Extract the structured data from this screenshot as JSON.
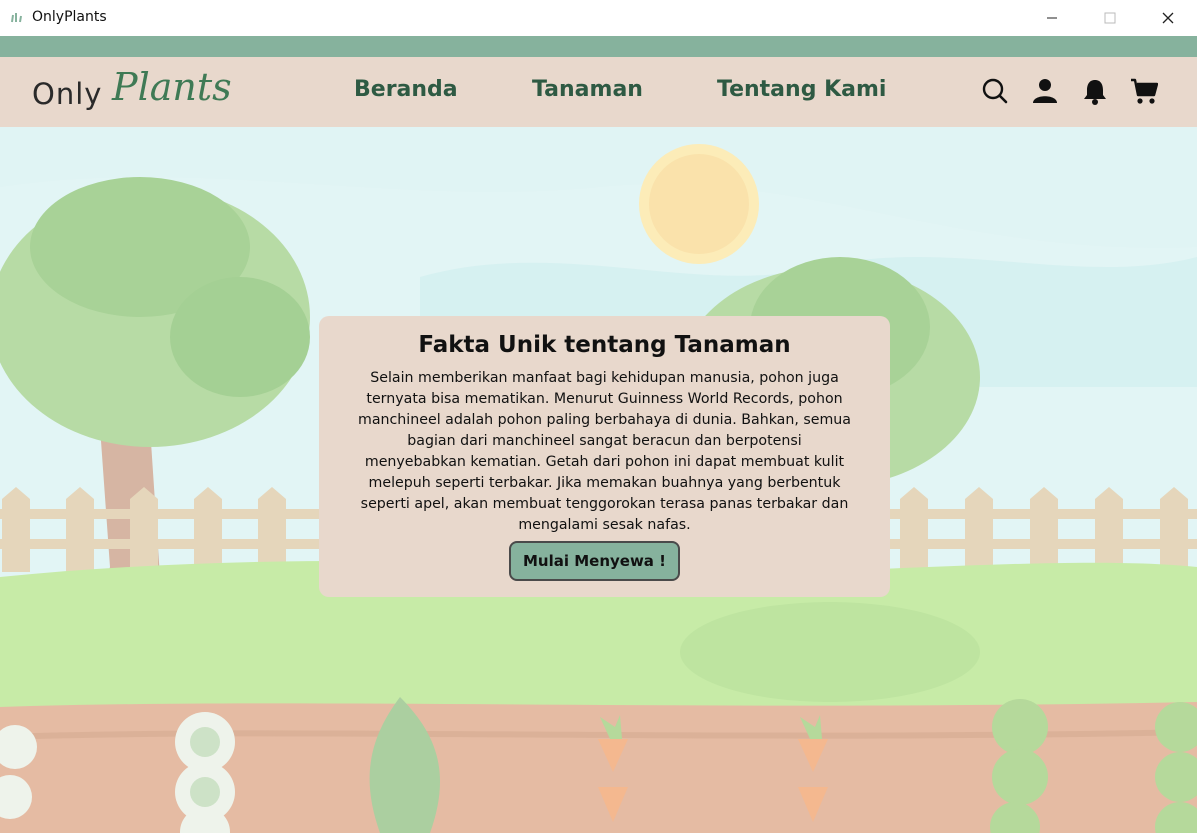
{
  "window": {
    "title": "OnlyPlants",
    "icon": "plant-icon"
  },
  "header": {
    "logo_part1": "Only",
    "logo_part2": "Plants",
    "nav": [
      {
        "label": "Beranda"
      },
      {
        "label": "Tanaman"
      },
      {
        "label": "Tentang Kami"
      }
    ],
    "icons": [
      "search-icon",
      "user-icon",
      "bell-icon",
      "cart-icon"
    ]
  },
  "card": {
    "title": "Fakta Unik tentang Tanaman",
    "body": "Selain memberikan manfaat bagi kehidupan manusia, pohon juga ternyata bisa mematikan. Menurut Guinness World Records, pohon manchineel adalah pohon paling berbahaya di dunia. Bahkan, semua bagian dari manchineel sangat beracun dan berpotensi menyebabkan kematian. Getah dari pohon ini dapat membuat kulit melepuh seperti terbakar. Jika memakan buahnya yang berbentuk seperti apel, akan membuat tenggorokan terasa panas terbakar dan mengalami sesak nafas.",
    "button": "Mulai Menyewa !"
  },
  "colors": {
    "accent": "#86b29d",
    "nav_bg": "#e8d8cc",
    "nav_text": "#2e5a43"
  }
}
